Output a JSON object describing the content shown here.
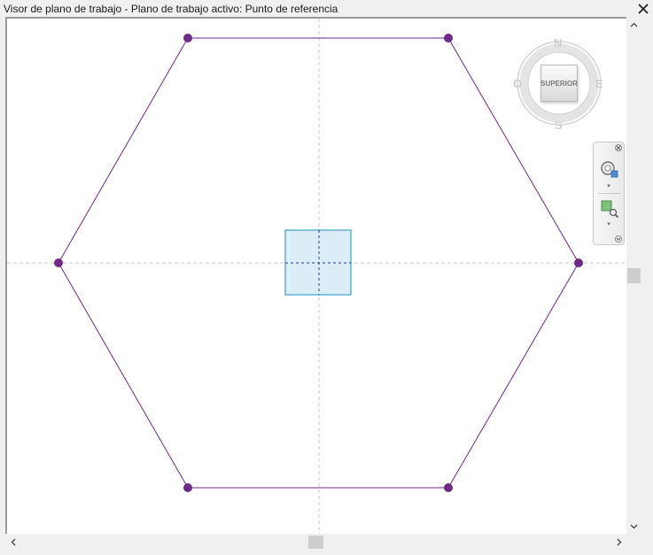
{
  "window": {
    "title": "Visor de plano de trabajo - Plano de trabajo activo: Punto de referencia",
    "close_glyph": "✕"
  },
  "viewcube": {
    "face_label": "SUPERIOR",
    "north": "N",
    "east": "E",
    "south": "S",
    "west": "O"
  },
  "navbar": {
    "tools": [
      "steering-wheel-icon",
      "zoom-region-icon"
    ],
    "dropdown_glyph": "▾",
    "close_glyph": "✕",
    "options_glyph": "▾"
  },
  "scrollbars": {
    "up": "˄",
    "down": "˅",
    "left": "‹",
    "right": "›"
  },
  "colors": {
    "hexagon": "#6e2a86",
    "vertex": "#6e2a86",
    "work_plane_fill": "#dbeef7",
    "work_plane_border": "#1b8ebf",
    "axis": "#c8c8c8",
    "plane_axis": "#2a3f9c"
  }
}
